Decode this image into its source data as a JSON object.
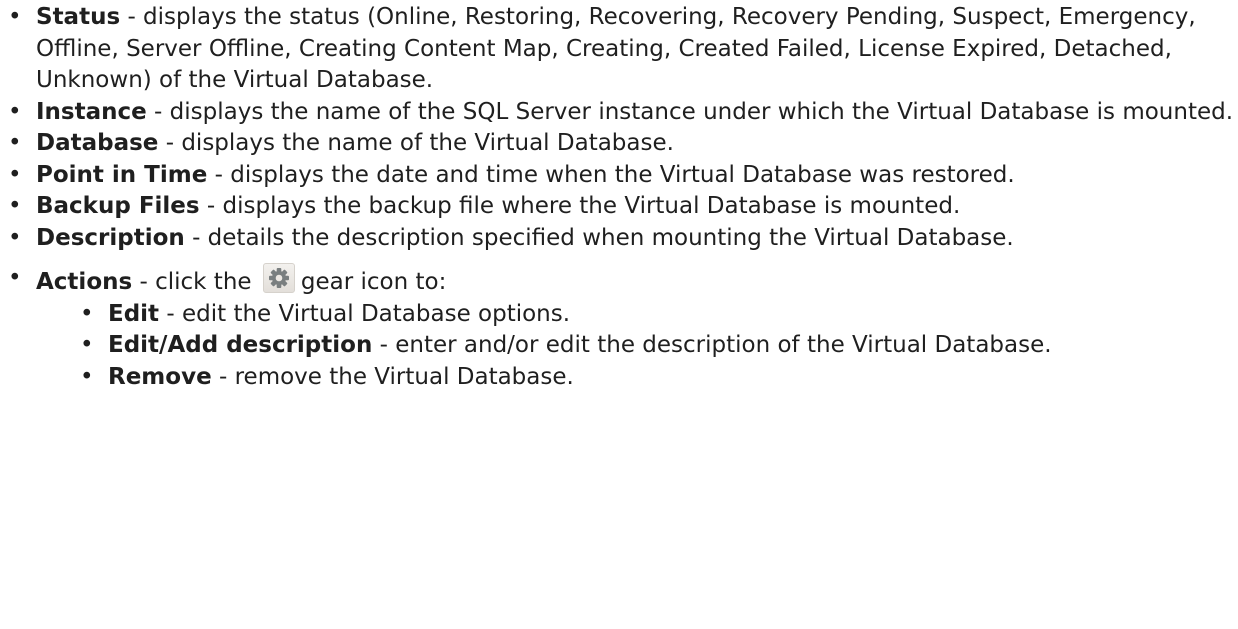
{
  "items": [
    {
      "term": "Status",
      "text": " - displays the status (Online, Restoring, Recovering, Recovery Pending, Suspect, Emergency, Offline, Server Offline, Creating Content Map, Creating, Created Failed, License Expired, Detached, Unknown) of the Virtual Database."
    },
    {
      "term": "Instance",
      "text": " - displays the name of the SQL Server instance under which the Virtual Database is mounted."
    },
    {
      "term": "Database",
      "text": " - displays the name of the Virtual Database."
    },
    {
      "term": "Point in Time",
      "text": " - displays the date and time when the Virtual Database was restored."
    },
    {
      "term": "Backup Files",
      "text": " - displays the backup file where the Virtual Database is mounted."
    },
    {
      "term": "Description",
      "text": " - details the description specified when mounting the Virtual Database."
    }
  ],
  "actions": {
    "term": "Actions",
    "text_before": " - click the ",
    "icon": "gear-icon",
    "text_after": "gear icon to:",
    "sub_items": [
      {
        "term": "Edit",
        "text": " - edit the Virtual Database options."
      },
      {
        "term": "Edit/Add description",
        "text": " - enter and/or edit the description of the Virtual Database."
      },
      {
        "term": "Remove",
        "text": " - remove the Virtual Database."
      }
    ]
  }
}
